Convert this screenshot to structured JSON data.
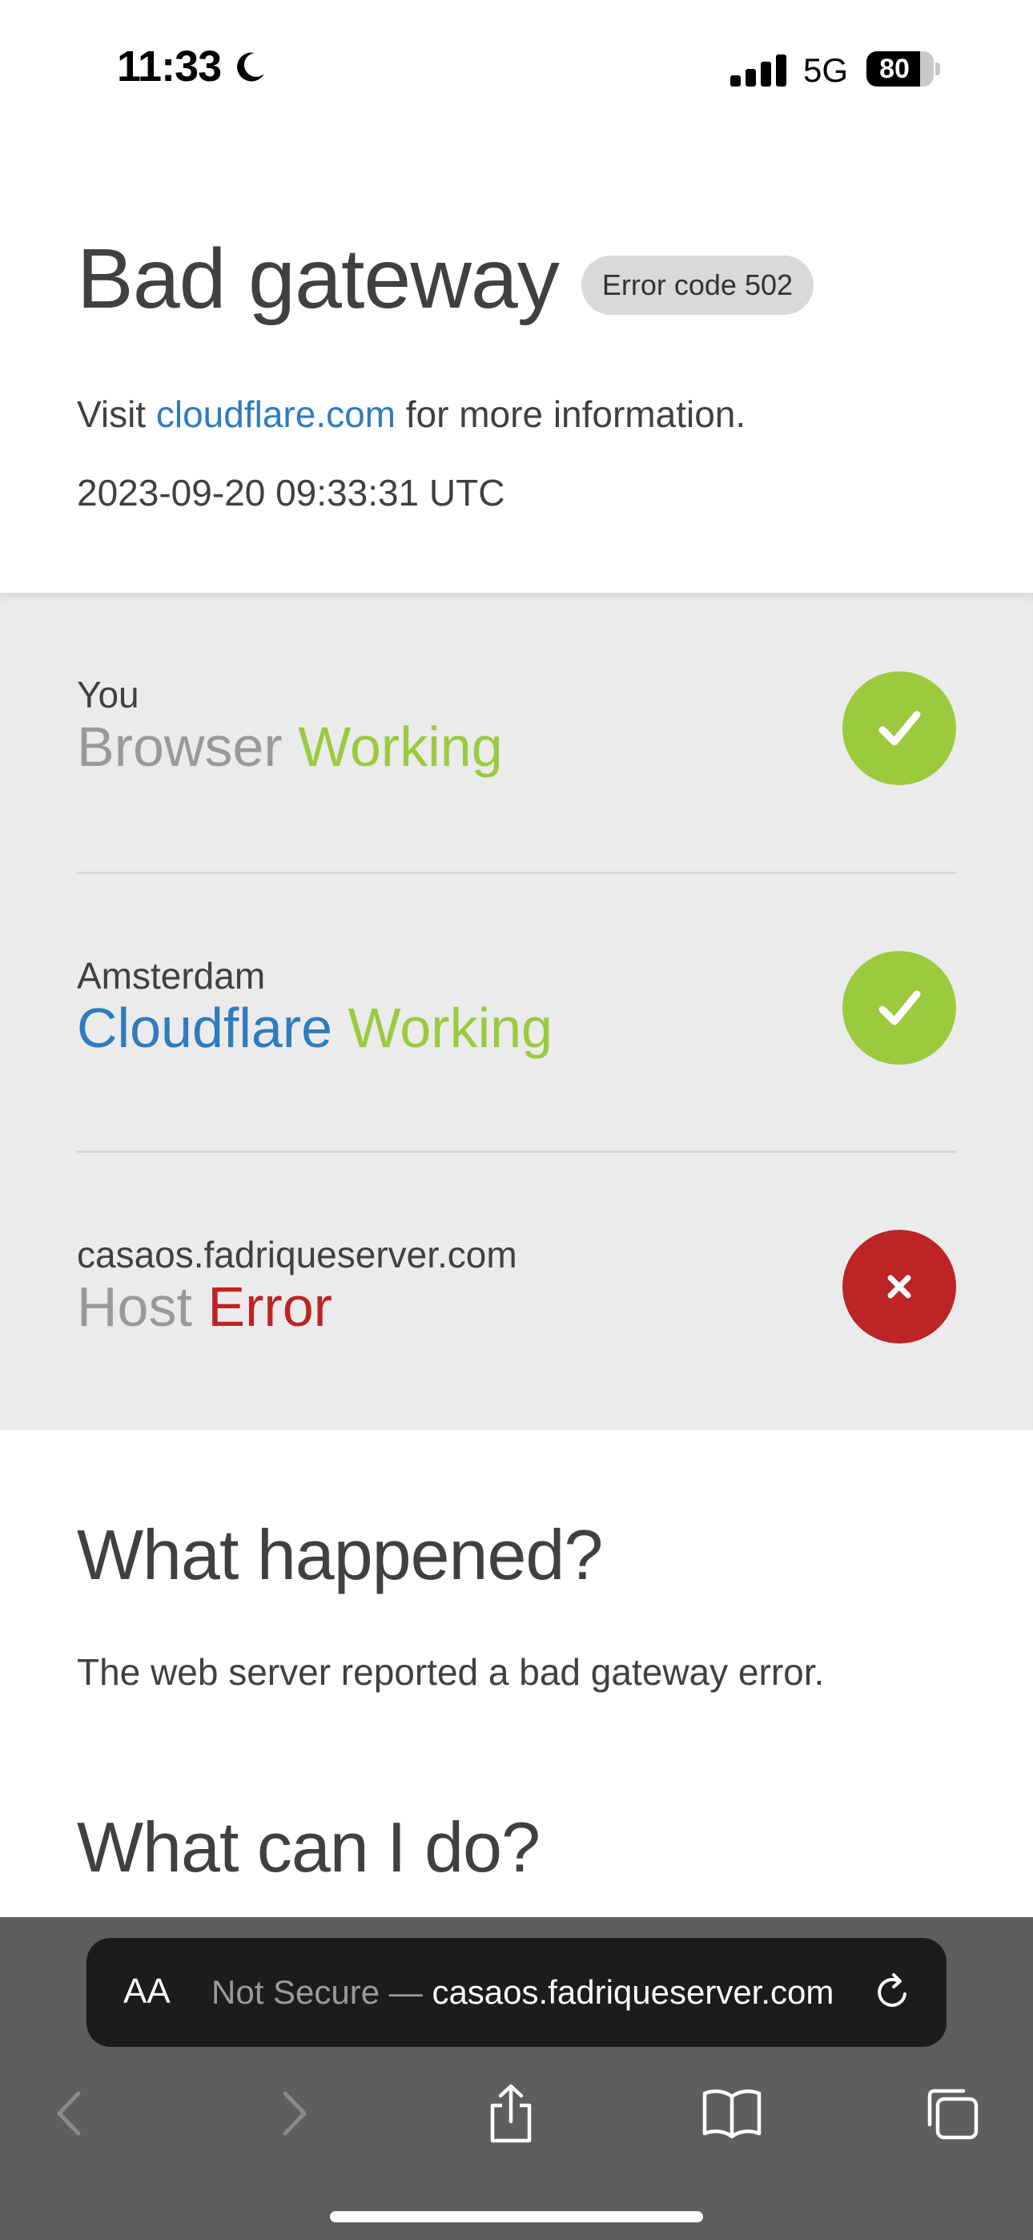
{
  "status_bar": {
    "time": "11:33",
    "network": "5G",
    "battery": "80",
    "battery_level_percent": 80
  },
  "header": {
    "title": "Bad gateway",
    "error_badge": "Error code 502",
    "info_prefix": "Visit ",
    "info_link": "cloudflare.com",
    "info_suffix": " for more information.",
    "timestamp": "2023-09-20 09:33:31 UTC"
  },
  "nodes": [
    {
      "location": "You",
      "name": "Browser",
      "status": "Working",
      "icon": "check-icon"
    },
    {
      "location": "Amsterdam",
      "name": "Cloudflare",
      "status": "Working",
      "icon": "check-icon"
    },
    {
      "location": "casaos.fadriqueserver.com",
      "name": "Host",
      "status": "Error",
      "icon": "close-icon"
    }
  ],
  "what_happened": {
    "title": "What happened?",
    "text": "The web server reported a bad gateway error."
  },
  "what_can_i_do": {
    "title": "What can I do?"
  },
  "safari": {
    "aa_label": "AA",
    "url_prefix": "Not Secure — ",
    "url": "casaos.fadriqueserver.com",
    "toolbar": [
      "back-icon",
      "forward-icon",
      "share-icon",
      "bookmarks-icon",
      "tabs-icon"
    ]
  },
  "colors": {
    "ok": "#9bca3e",
    "error": "#bd2426",
    "link": "#2f7bbf",
    "panel": "#ebebeb"
  }
}
